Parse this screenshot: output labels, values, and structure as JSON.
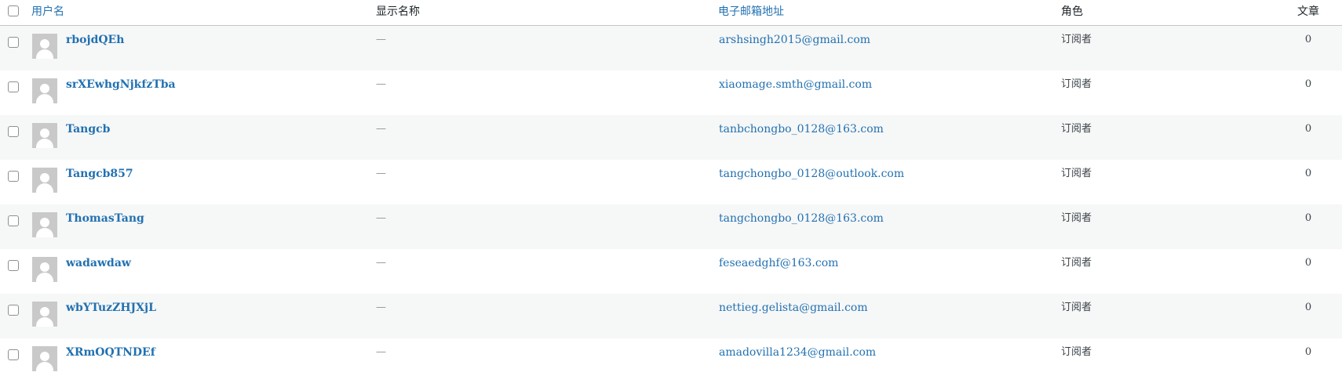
{
  "columns": {
    "username": "用户名",
    "display_name": "显示名称",
    "email": "电子邮箱地址",
    "role": "角色",
    "posts": "文章"
  },
  "colors": {
    "link": "#2271b1",
    "row_alt": "#f6f7f7",
    "border": "#c3c4c7"
  },
  "icons": {
    "avatar": "default-avatar-icon",
    "checkbox": "checkbox"
  },
  "users": [
    {
      "username": "rbojdQEh",
      "display_name": "—",
      "email": "arshsingh2015@gmail.com",
      "role": "订阅者",
      "posts": "0"
    },
    {
      "username": "srXEwhgNjkfzTba",
      "display_name": "—",
      "email": "xiaomage.smth@gmail.com",
      "role": "订阅者",
      "posts": "0"
    },
    {
      "username": "Tangcb",
      "display_name": "—",
      "email": "tanbchongbo_0128@163.com",
      "role": "订阅者",
      "posts": "0"
    },
    {
      "username": "Tangcb857",
      "display_name": "—",
      "email": "tangchongbo_0128@outlook.com",
      "role": "订阅者",
      "posts": "0"
    },
    {
      "username": "ThomasTang",
      "display_name": "—",
      "email": "tangchongbo_0128@163.com",
      "role": "订阅者",
      "posts": "0"
    },
    {
      "username": "wadawdaw",
      "display_name": "—",
      "email": "feseaedghf@163.com",
      "role": "订阅者",
      "posts": "0"
    },
    {
      "username": "wbYTuzZHJXjL",
      "display_name": "—",
      "email": "nettieg.gelista@gmail.com",
      "role": "订阅者",
      "posts": "0"
    },
    {
      "username": "XRmOQTNDEf",
      "display_name": "—",
      "email": "amadovilla1234@gmail.com",
      "role": "订阅者",
      "posts": "0"
    }
  ]
}
